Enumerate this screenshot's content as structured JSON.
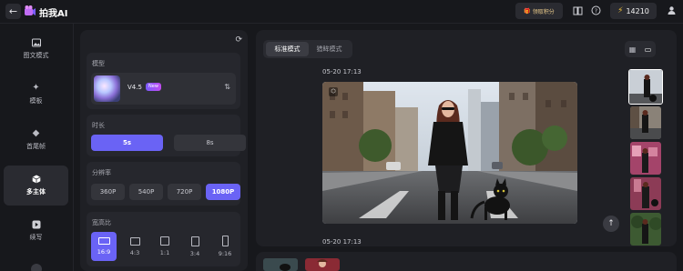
{
  "app": {
    "title": "拍我AI"
  },
  "topbar": {
    "rewards_label": "领取积分",
    "credits": "14210",
    "icons": [
      "back-arrow-icon",
      "book-icon",
      "help-icon",
      "lightning-icon",
      "user-icon"
    ]
  },
  "sidebar": {
    "items": [
      {
        "label": "图文模式",
        "icon": "image-icon"
      },
      {
        "label": "模板",
        "icon": "sparkle-icon"
      },
      {
        "label": "首尾帧",
        "icon": "diamond-frame-icon"
      },
      {
        "label": "多主体",
        "icon": "cube-icon",
        "active": true
      },
      {
        "label": "续写",
        "icon": "play-square-icon"
      }
    ]
  },
  "panel": {
    "model": {
      "title": "模型",
      "name": "V4.5",
      "badge": "New"
    },
    "duration": {
      "title": "时长",
      "options": [
        "5s",
        "8s"
      ],
      "selected": "5s"
    },
    "resolution": {
      "title": "分辨率",
      "options": [
        "360P",
        "540P",
        "720P",
        "1080P"
      ],
      "selected": "1080P"
    },
    "aspect": {
      "title": "宽高比",
      "options": [
        "16:9",
        "4:3",
        "1:1",
        "3:4",
        "9:16"
      ],
      "selected": "16:9"
    }
  },
  "main": {
    "tabs": [
      "标准模式",
      "猎眸模式"
    ],
    "active_tab": "标准模式",
    "entries": [
      {
        "timestamp": "05-20 17:13"
      },
      {
        "timestamp": "05-20 17:13"
      }
    ]
  },
  "colors": {
    "accent": "#6a63f5",
    "badge_from": "#7b5cff",
    "badge_to": "#c14cf0",
    "credit_bolt": "#f5c33b"
  }
}
